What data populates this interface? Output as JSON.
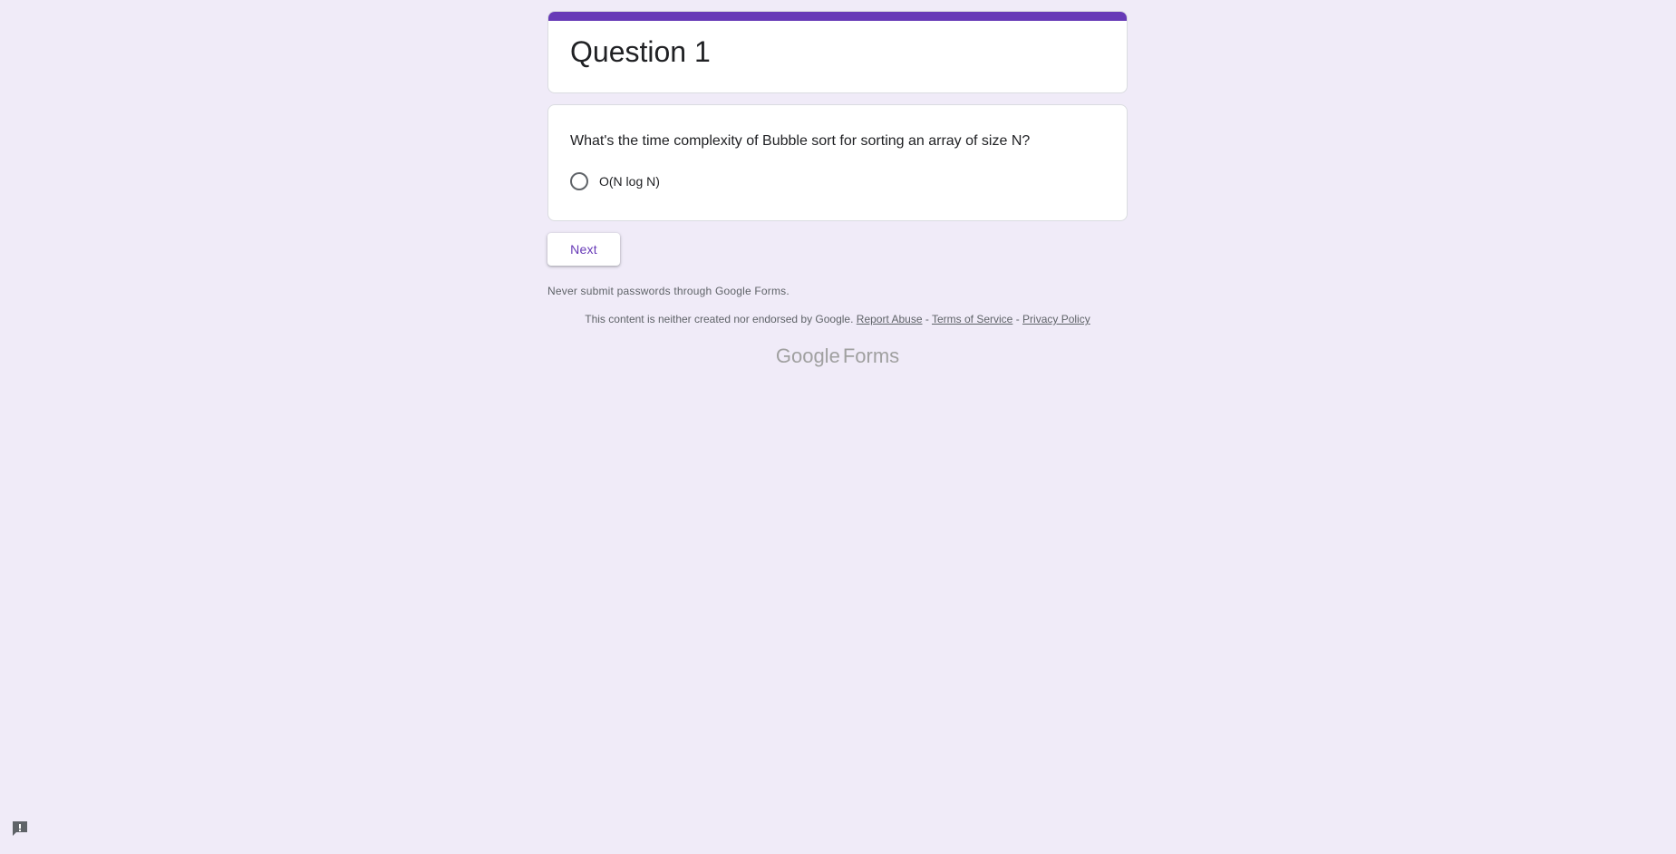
{
  "form": {
    "title": "Question 1",
    "accent_color": "#673ab7",
    "background_color": "#f0ebf8"
  },
  "question": {
    "text": "What's the time complexity of Bubble sort for sorting an array of size N?",
    "options": [
      {
        "label": "O(N log N)",
        "selected": false
      }
    ]
  },
  "navigation": {
    "next_label": "Next"
  },
  "footer": {
    "warning": "Never submit passwords through Google Forms.",
    "disclaimer": "This content is neither created nor endorsed by Google.",
    "report_abuse": "Report Abuse",
    "separator": "-",
    "terms": "Terms of Service",
    "privacy": "Privacy Policy",
    "logo_google": "Google",
    "logo_forms": "Forms"
  },
  "icons": {
    "feedback": "feedback-icon",
    "radio": "radio-unchecked-icon"
  }
}
